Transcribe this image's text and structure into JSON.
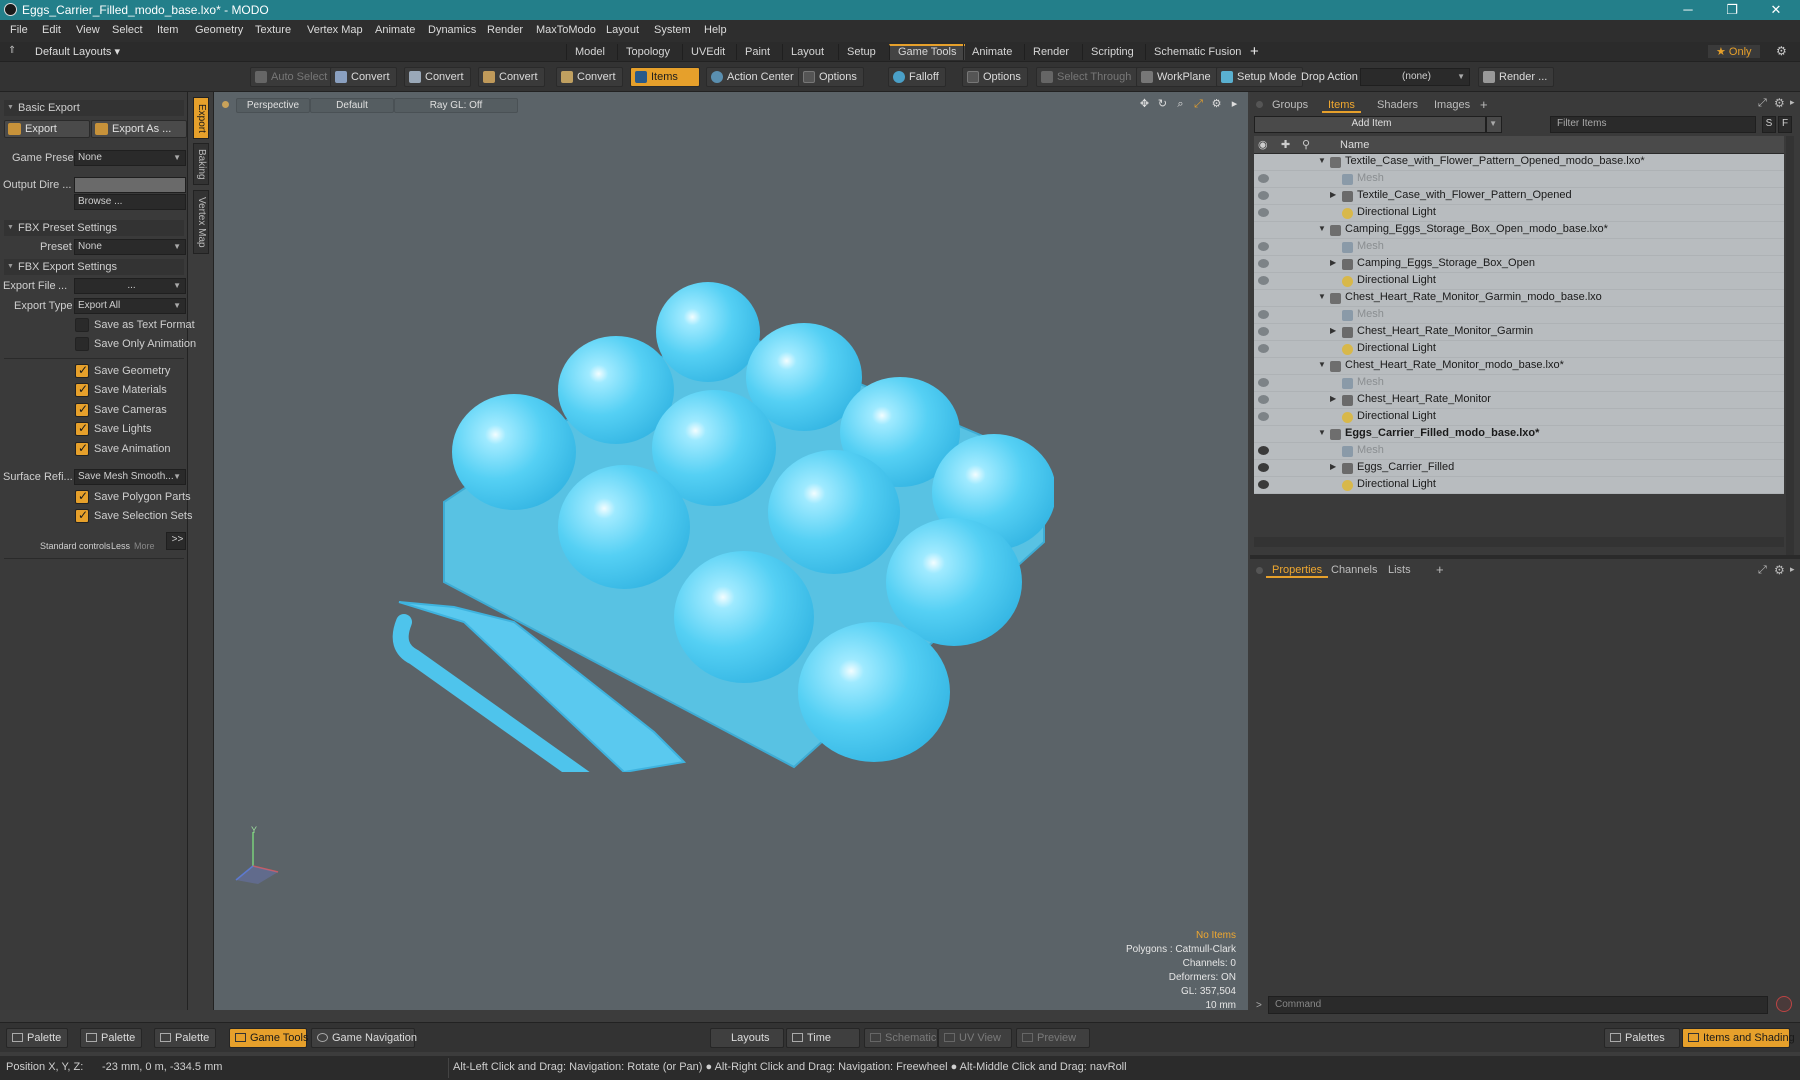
{
  "window": {
    "title": "Eggs_Carrier_Filled_modo_base.lxo* - MODO"
  },
  "menubar": {
    "items": [
      "File",
      "Edit",
      "View",
      "Select",
      "Item",
      "Geometry",
      "Texture",
      "Vertex Map",
      "Animate",
      "Dynamics",
      "Render",
      "MaxToModo",
      "Layout",
      "System",
      "Help"
    ]
  },
  "layouts": {
    "default_layouts": "Default Layouts ▾",
    "tabs": [
      "Model",
      "Topology",
      "UVEdit",
      "Paint",
      "Layout",
      "Setup",
      "Game Tools",
      "Animate",
      "Render",
      "Scripting",
      "Schematic Fusion"
    ],
    "active_tab": "Game Tools",
    "add": "+",
    "only": "★ Only"
  },
  "toolbar": {
    "auto_select": "Auto Select",
    "convert1": "Convert",
    "convert2": "Convert",
    "convert3": "Convert",
    "convert4": "Convert",
    "items": "Items",
    "action_center": "Action Center",
    "options1": "Options",
    "falloff": "Falloff",
    "options2": "Options",
    "select_through": "Select Through",
    "workplane": "WorkPlane",
    "setup_mode": "Setup Mode",
    "drop_action": "Drop Action",
    "drop_value": "(none)",
    "render": "Render ..."
  },
  "left_panel": {
    "basic_export": "Basic Export",
    "export_btn": "Export",
    "export_as_btn": "Export As ...",
    "game_preset_label": "Game Preset",
    "game_preset_value": "None",
    "output_dir_label": "Output Dire ...",
    "output_dir_value": "",
    "browse": "Browse ...",
    "fbx_preset_settings": "FBX Preset Settings",
    "preset_label": "Preset",
    "preset_value": "None",
    "fbx_export_settings": "FBX Export Settings",
    "export_file_label": "Export File",
    "export_file_dots": "...",
    "export_file_value": "...",
    "export_type_label": "Export Type",
    "export_type_value": "Export All",
    "save_text": "Save as Text Format",
    "save_only_anim": "Save Only Animation",
    "save_geometry": "Save Geometry",
    "save_materials": "Save Materials",
    "save_cameras": "Save Cameras",
    "save_lights": "Save Lights",
    "save_animation": "Save Animation",
    "surface_label": "Surface Refi...",
    "surface_value": "Save Mesh Smooth...",
    "save_polygon_parts": "Save Polygon Parts",
    "save_selection_sets": "Save Selection Sets",
    "standard_controls": "Standard controls",
    "less": "Less",
    "more": "More",
    "expand": ">>",
    "side_tabs": [
      "Export",
      "Baking",
      "Vertex Map"
    ]
  },
  "viewport": {
    "perspective": "Perspective",
    "default": "Default",
    "raygl": "Ray GL: Off",
    "axis_y": "Y",
    "info": {
      "no_items": "No Items",
      "polygons": "Polygons : Catmull-Clark",
      "channels": "Channels: 0",
      "deformers": "Deformers: ON",
      "gl": "GL: 357,504",
      "scale": "10 mm"
    }
  },
  "right_panel": {
    "tabs": [
      "Groups",
      "Items",
      "Shaders",
      "Images"
    ],
    "active_tab": "Items",
    "add_item": "Add Item",
    "filter_placeholder": "Filter Items",
    "s": "S",
    "f": "F",
    "name_header": "Name",
    "tree": [
      {
        "label": "Textile_Case_with_Flower_Pattern_Opened_modo_base.lxo*",
        "level": 0,
        "kind": "scene"
      },
      {
        "label": "Mesh",
        "level": 1,
        "kind": "mesh"
      },
      {
        "label": "Textile_Case_with_Flower_Pattern_Opened",
        "level": 1,
        "kind": "group"
      },
      {
        "label": "Directional Light",
        "level": 1,
        "kind": "light"
      },
      {
        "label": "Camping_Eggs_Storage_Box_Open_modo_base.lxo*",
        "level": 0,
        "kind": "scene"
      },
      {
        "label": "Mesh",
        "level": 1,
        "kind": "mesh"
      },
      {
        "label": "Camping_Eggs_Storage_Box_Open",
        "level": 1,
        "kind": "group"
      },
      {
        "label": "Directional Light",
        "level": 1,
        "kind": "light"
      },
      {
        "label": "Chest_Heart_Rate_Monitor_Garmin_modo_base.lxo",
        "level": 0,
        "kind": "scene"
      },
      {
        "label": "Mesh",
        "level": 1,
        "kind": "mesh"
      },
      {
        "label": "Chest_Heart_Rate_Monitor_Garmin",
        "level": 1,
        "kind": "group"
      },
      {
        "label": "Directional Light",
        "level": 1,
        "kind": "light"
      },
      {
        "label": "Chest_Heart_Rate_Monitor_modo_base.lxo*",
        "level": 0,
        "kind": "scene"
      },
      {
        "label": "Mesh",
        "level": 1,
        "kind": "mesh"
      },
      {
        "label": "Chest_Heart_Rate_Monitor",
        "level": 1,
        "kind": "group"
      },
      {
        "label": "Directional Light",
        "level": 1,
        "kind": "light"
      },
      {
        "label": "Eggs_Carrier_Filled_modo_base.lxo*",
        "level": 0,
        "kind": "scene-active"
      },
      {
        "label": "Mesh",
        "level": 1,
        "kind": "mesh"
      },
      {
        "label": "Eggs_Carrier_Filled",
        "level": 1,
        "kind": "group"
      },
      {
        "label": "Directional Light",
        "level": 1,
        "kind": "light"
      }
    ],
    "props_tabs": [
      "Properties",
      "Channels",
      "Lists"
    ],
    "props_active": "Properties",
    "command_placeholder": "Command"
  },
  "bottombar": {
    "palette1": "Palette",
    "palette2": "Palette",
    "palette3": "Palette",
    "game_tools": "Game Tools",
    "game_navigation": "Game Navigation",
    "layouts": "Layouts",
    "time": "Time",
    "schematic": "Schematic",
    "uv_view": "UV View",
    "preview": "Preview",
    "palettes": "Palettes",
    "items_shading": "Items and Shading"
  },
  "statusbar": {
    "position_label": "Position X, Y, Z:",
    "position_value": "-23 mm, 0 m, -334.5 mm",
    "hint": "Alt-Left Click and Drag: Navigation: Rotate (or Pan) ● Alt-Right Click and Drag: Navigation: Freewheel ● Alt-Middle Click and Drag: navRoll"
  },
  "colors": {
    "accent": "#e6a02b",
    "title_bar": "#237f8a",
    "viewport_bg": "#5b6368",
    "egg": "#5fd6f5"
  }
}
